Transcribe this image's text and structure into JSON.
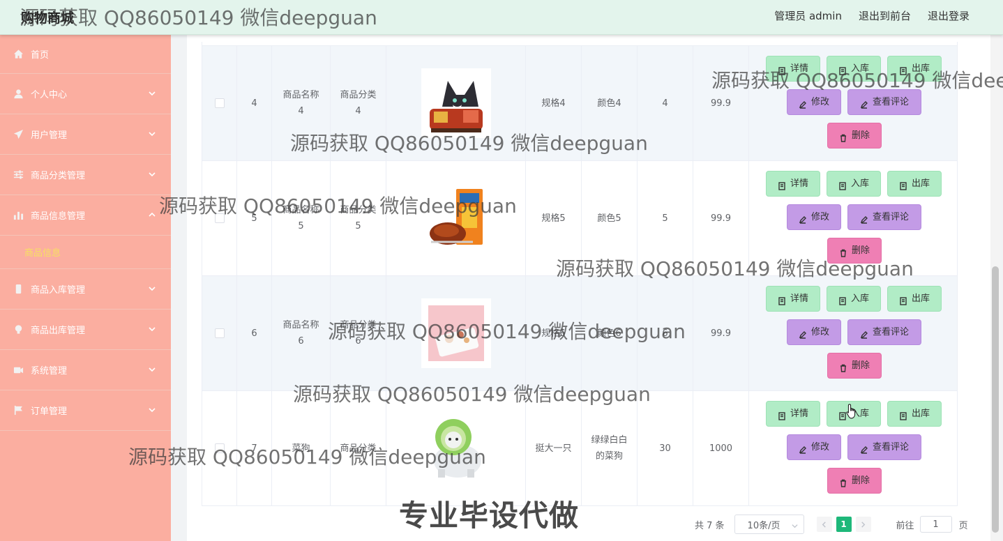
{
  "header": {
    "brand": "购物商城",
    "user_label": "管理员 admin",
    "to_front": "退出到前台",
    "logout": "退出登录"
  },
  "sidebar": {
    "items": [
      {
        "label": "首页",
        "icon": "home-icon"
      },
      {
        "label": "个人中心",
        "icon": "user-icon"
      },
      {
        "label": "用户管理",
        "icon": "send-icon"
      },
      {
        "label": "商品分类管理",
        "icon": "sliders-icon"
      },
      {
        "label": "商品信息管理",
        "icon": "bar-chart-icon",
        "expanded": true
      },
      {
        "label": "商品入库管理",
        "icon": "phone-icon"
      },
      {
        "label": "商品出库管理",
        "icon": "bulb-icon"
      },
      {
        "label": "系统管理",
        "icon": "camera-icon"
      },
      {
        "label": "订单管理",
        "icon": "flag-icon"
      }
    ],
    "active_sub": "商品信息"
  },
  "table": {
    "rows": [
      {
        "index": "4",
        "name": "商品名称4",
        "category": "商品分类4",
        "spec": "规格4",
        "color": "颜色4",
        "stock": "4",
        "price": "99.9"
      },
      {
        "index": "5",
        "name": "商品名称5",
        "category": "商品分类5",
        "spec": "规格5",
        "color": "颜色5",
        "stock": "5",
        "price": "99.9"
      },
      {
        "index": "6",
        "name": "商品名称6",
        "category": "商品分类6",
        "spec": "规格6",
        "color": "颜色6",
        "stock": "6",
        "price": "99.9"
      },
      {
        "index": "7",
        "name": "菜狗",
        "category": "商品分类",
        "spec": "挺大一只",
        "color": "绿绿白白的菜狗",
        "stock": "30",
        "price": "1000"
      }
    ],
    "actions": {
      "detail": "详情",
      "stock_in": "入库",
      "stock_out": "出库",
      "edit": "修改",
      "view_comments": "查看评论",
      "delete": "删除"
    }
  },
  "pagination": {
    "total": "共 7 条",
    "page_size": "10条/页",
    "current_page": "1",
    "goto_label": "前往",
    "goto_value": "1",
    "page_suffix": "页"
  },
  "watermark": {
    "text": "源码获取 QQ86050149 微信deepguan",
    "bottom_text": "专业毕设代做"
  },
  "colors": {
    "header_bg": "#e3f4ec",
    "sidebar_bg": "#fbaea0",
    "active_sub": "#f7e160",
    "btn_green": "#b1ecc6",
    "btn_purple": "#c39be6",
    "btn_pink": "#ef7fb4",
    "page_active": "#1eb87a"
  }
}
